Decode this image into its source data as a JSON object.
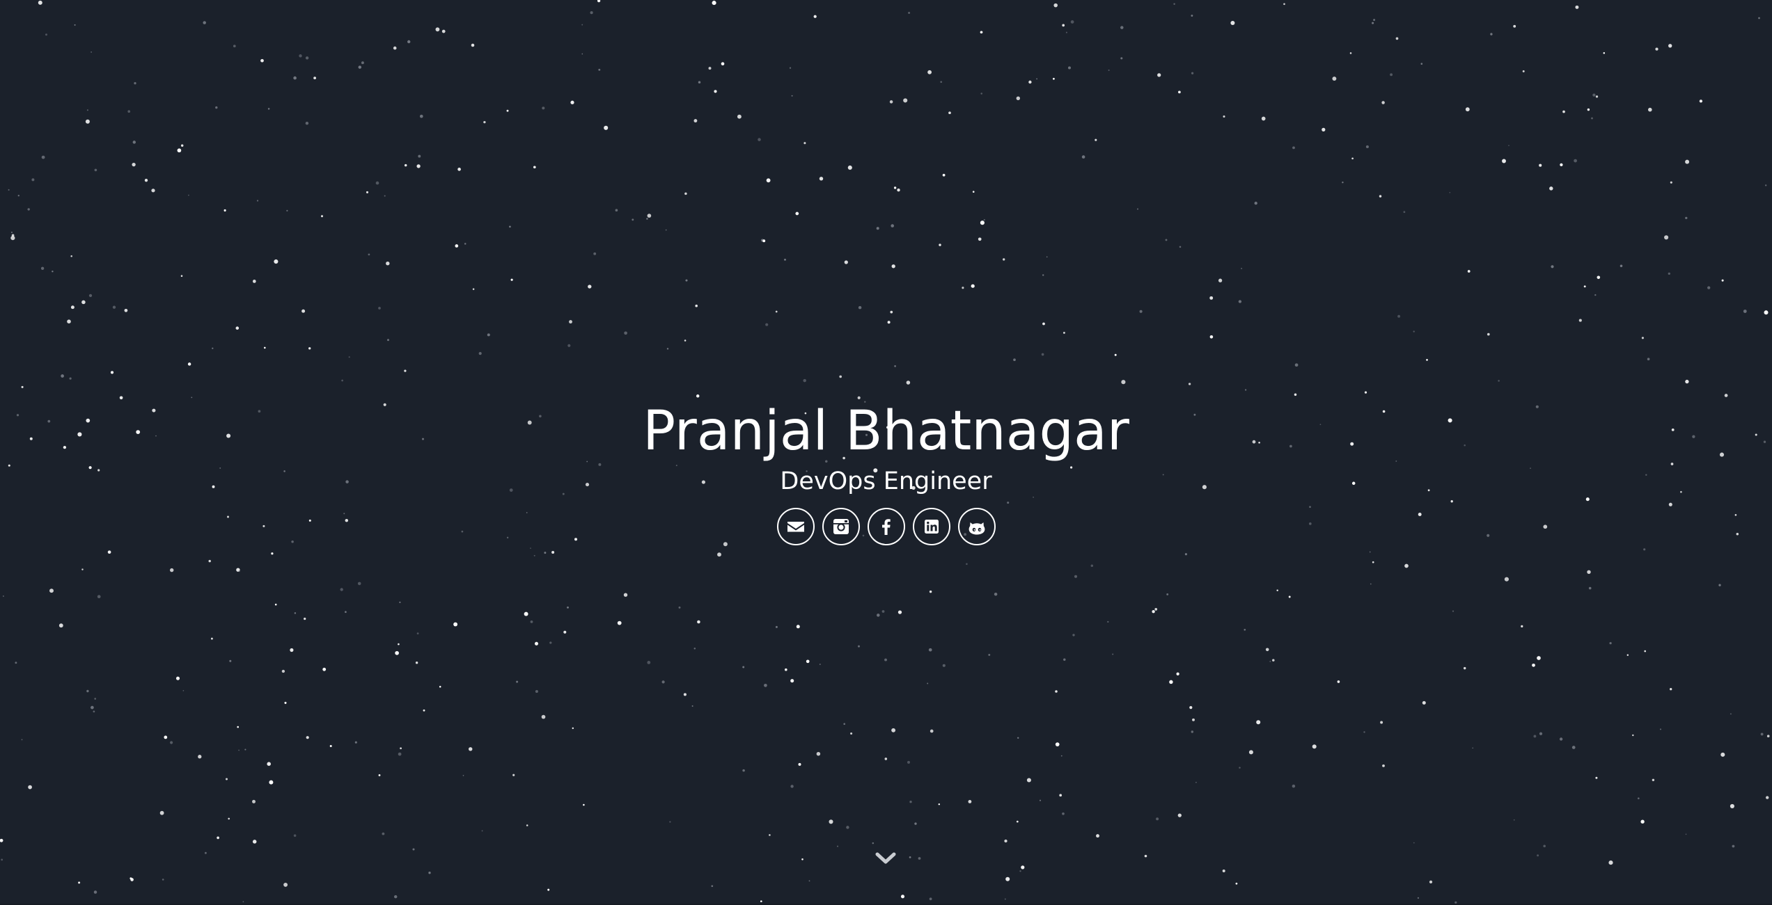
{
  "profile": {
    "name": "Pranjal Bhatnagar",
    "role": "DevOps Engineer"
  },
  "social_links": [
    {
      "icon": "envelope-icon",
      "label": "Email"
    },
    {
      "icon": "instagram-icon",
      "label": "Instagram"
    },
    {
      "icon": "facebook-icon",
      "label": "Facebook"
    },
    {
      "icon": "linkedin-icon",
      "label": "LinkedIn"
    },
    {
      "icon": "github-icon",
      "label": "GitHub"
    }
  ],
  "scroll_indicator": {
    "icon": "chevron-down-icon"
  },
  "colors": {
    "background": "#1b212b",
    "text": "#ffffff",
    "star": "#ffffff",
    "star_dim": "#8a8f98"
  }
}
